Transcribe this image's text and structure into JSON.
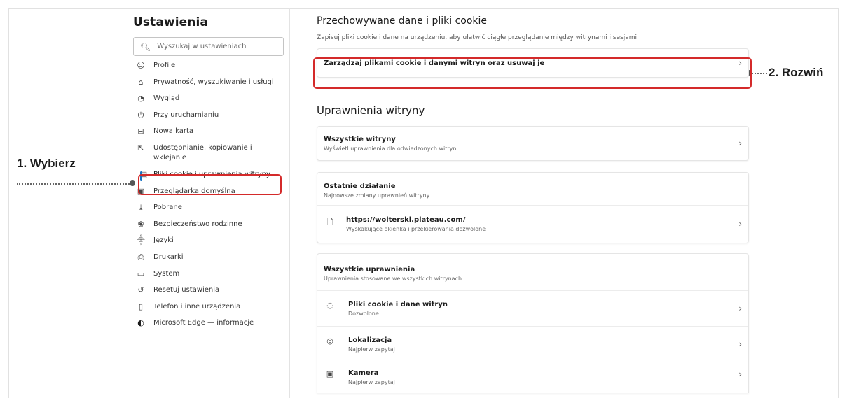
{
  "sidebar": {
    "title": "Ustawienia",
    "search_placeholder": "Wyszukaj w ustawieniach",
    "items": [
      {
        "label": "Profile",
        "icon": "profile-icon"
      },
      {
        "label": "Prywatność, wyszukiwanie i usługi",
        "icon": "lock-icon"
      },
      {
        "label": "Wygląd",
        "icon": "appearance-icon"
      },
      {
        "label": "Przy uruchamianiu",
        "icon": "power-icon"
      },
      {
        "label": "Nowa karta",
        "icon": "new-tab-icon"
      },
      {
        "label": "Udostępnianie, kopiowanie i wklejanie",
        "icon": "share-icon"
      },
      {
        "label": "Pliki cookie i uprawnienia witryny",
        "icon": "cookie-settings-icon"
      },
      {
        "label": "Przeglądarka domyślna",
        "icon": "default-browser-icon"
      },
      {
        "label": "Pobrane",
        "icon": "download-icon"
      },
      {
        "label": "Bezpieczeństwo rodzinne",
        "icon": "family-icon"
      },
      {
        "label": "Języki",
        "icon": "language-icon"
      },
      {
        "label": "Drukarki",
        "icon": "printer-icon"
      },
      {
        "label": "System",
        "icon": "system-icon"
      },
      {
        "label": "Resetuj ustawienia",
        "icon": "reset-icon"
      },
      {
        "label": "Telefon i inne urządzenia",
        "icon": "phone-icon"
      },
      {
        "label": "Microsoft Edge — informacje",
        "icon": "edge-icon"
      }
    ]
  },
  "annotations": {
    "step1": "1. Wybierz",
    "step2": "2. Rozwiń"
  },
  "stored": {
    "title": "Przechowywane dane i pliki cookie",
    "subtitle": "Zapisuj pliki cookie i dane na urządzeniu, aby ułatwić ciągłe przeglądanie między witrynami i sesjami",
    "manage_label": "Zarządzaj plikami cookie i danymi witryn oraz usuwaj je"
  },
  "permissions": {
    "title": "Uprawnienia witryny",
    "all_sites": {
      "title": "Wszystkie witryny",
      "desc": "Wyświetl uprawnienia dla odwiedzonych witryn"
    },
    "recent": {
      "title": "Ostatnie działanie",
      "desc": "Najnowsze zmiany uprawnień witryny",
      "site": {
        "url": "https://wolterskl.plateau.com/",
        "desc": "Wyskakujące okienka i przekierowania dozwolone"
      }
    },
    "all_permissions": {
      "title": "Wszystkie uprawnienia",
      "desc": "Uprawnienia stosowane we wszystkich witrynach",
      "items": [
        {
          "title": "Pliki cookie i dane witryn",
          "desc": "Dozwolone",
          "icon": "cookie-icon"
        },
        {
          "title": "Lokalizacja",
          "desc": "Najpierw zapytaj",
          "icon": "location-icon"
        },
        {
          "title": "Kamera",
          "desc": "Najpierw zapytaj",
          "icon": "camera-icon"
        }
      ]
    }
  }
}
